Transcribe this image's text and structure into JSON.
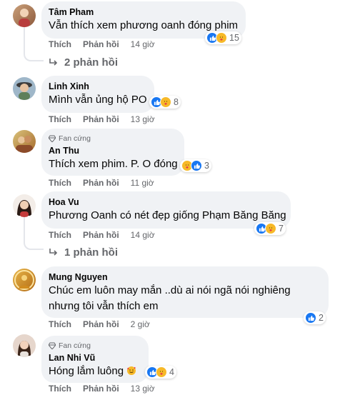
{
  "comments": [
    {
      "author": "Tâm Pham",
      "badge": "",
      "text": "Vẫn thích xem phương oanh đóng phim",
      "reaction_count": "15",
      "like_label": "Thích",
      "reply_label": "Phản hồi",
      "time": "14 giờ",
      "replies_label": "2 phản hồi"
    },
    {
      "author": "Linh Xinh",
      "badge": "",
      "text": "Mình vẫn ủng hộ PO",
      "reaction_count": "8",
      "like_label": "Thích",
      "reply_label": "Phản hồi",
      "time": "13 giờ"
    },
    {
      "author": "An Thu",
      "badge": "Fan cứng",
      "text": "Thích xem phim. P. O đóng",
      "reaction_count": "3",
      "like_label": "Thích",
      "reply_label": "Phản hồi",
      "time": "11 giờ"
    },
    {
      "author": "Hoa Vu",
      "badge": "",
      "text": "Phương Oanh có nét đẹp giống Phạm Băng Băng",
      "reaction_count": "7",
      "like_label": "Thích",
      "reply_label": "Phản hồi",
      "time": "14 giờ",
      "replies_label": "1 phản hồi"
    },
    {
      "author": "Mung Nguyen",
      "badge": "",
      "text_line1": "Chúc em luôn may mắn ..dù ai nói ngã nói nghiêng",
      "text_line2": "nhưng tôi vẫn thích em",
      "reaction_count": "2",
      "like_label": "Thích",
      "reply_label": "Phản hồi",
      "time": "2 giờ"
    },
    {
      "author": "Lan Nhi Vũ",
      "badge": "Fan cứng",
      "text": "Hóng lắm luông",
      "reaction_count": "4",
      "like_label": "Thích",
      "reply_label": "Phản hồi",
      "time": "13 giờ"
    }
  ],
  "icons": {
    "like": "like-reaction-icon",
    "care": "care-reaction-icon",
    "diamond": "diamond-badge-icon",
    "reply_arrow": "reply-arrow-icon",
    "emoji": "smiling-face-hearts-emoji"
  },
  "colors": {
    "bubble": "#f0f2f5",
    "like": "#1877f2",
    "care": "#f7b928",
    "secondary_text": "#65676b"
  }
}
